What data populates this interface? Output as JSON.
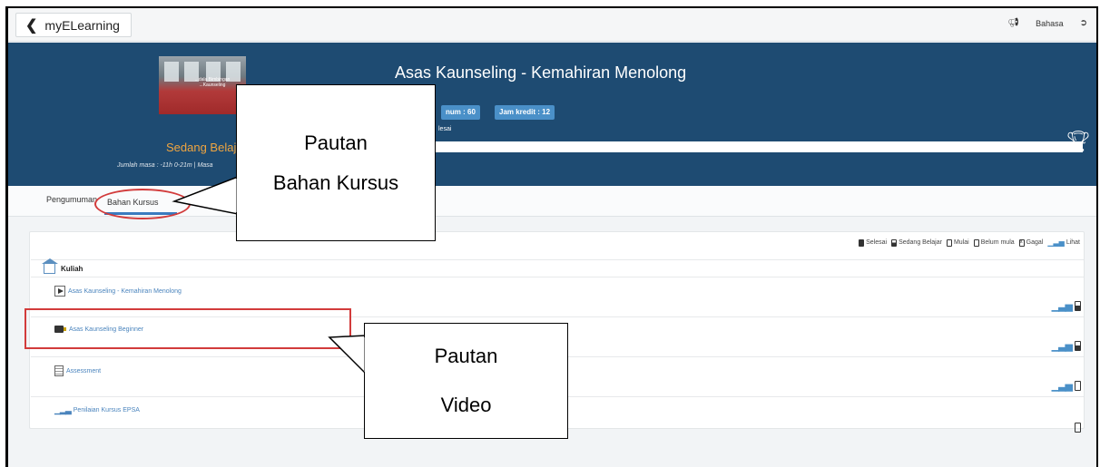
{
  "topbar": {
    "back_label": "myELearning",
    "language_label": "Bahasa",
    "icons": [
      "megaphone-icon",
      "logout-icon"
    ]
  },
  "header": {
    "course_title": "Asas Kaunseling - Kemahiran Menolong",
    "thumbnail_caption": "...dala Bimbingan ...Kaunseling",
    "badge_minimum": "num : 60",
    "badge_credit": "Jam kredit : 12",
    "status_small": "lesai",
    "status_label": "Sedang Belaj",
    "time_info": "Jumlah masa : -11h 0-21m  |  Masa",
    "colors": {
      "header_bg": "#1e4b72",
      "status": "#f0a540",
      "accent": "#4a90c8"
    }
  },
  "tabs": {
    "announcements": "Pengumuman",
    "course_material": "Bahan Kursus"
  },
  "legend": {
    "completed": "Selesai",
    "in_progress": "Sedang Belajar",
    "started": "Mulai",
    "not_started": "Belum mula",
    "failed": "Gagal",
    "view": "Lihat"
  },
  "section": {
    "title": "Kuliah",
    "items": [
      {
        "label": "Asas Kaunseling - Kemahiran Menolong",
        "icon": "play-icon",
        "status": "in-progress"
      },
      {
        "label": "Asas Kaunseling Beginner",
        "icon": "video-icon",
        "status": "in-progress"
      },
      {
        "label": "Assessment",
        "icon": "document-icon",
        "status": "not-started"
      },
      {
        "label": "Penilaian Kursus EPSA",
        "icon": "bar-chart-icon",
        "status": "not-started"
      }
    ]
  },
  "callouts": {
    "course_material_line1": "Pautan",
    "course_material_line2": "Bahan Kursus",
    "video_line1": "Pautan",
    "video_line2": "Video"
  }
}
